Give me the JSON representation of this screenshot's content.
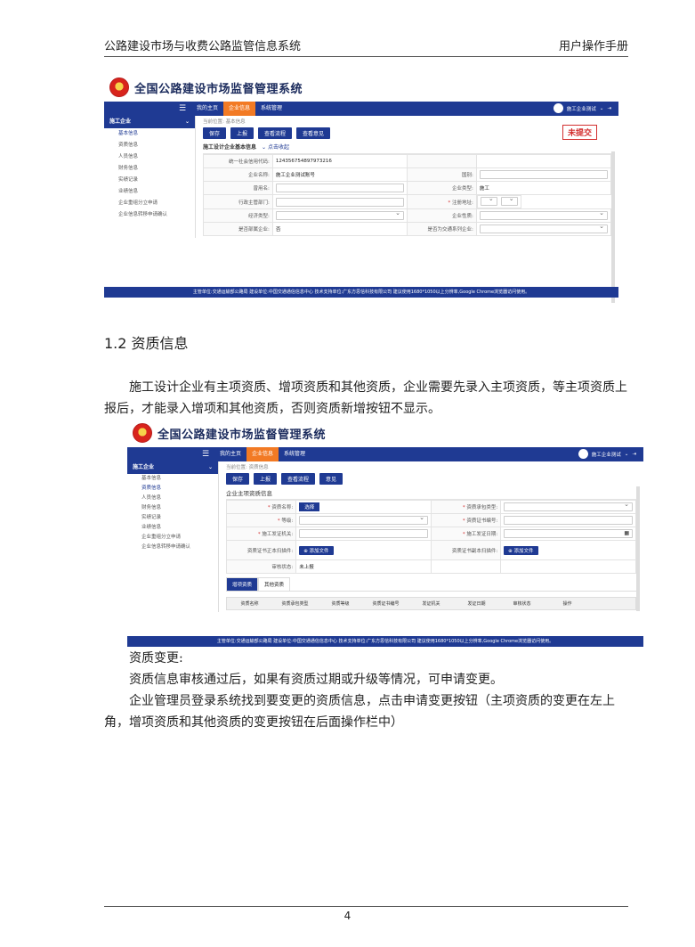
{
  "header": {
    "left": "公路建设市场与收费公路监管信息系统",
    "right": "用户操作手册"
  },
  "app": {
    "title": "全国公路建设市场监督管理系统",
    "nav": [
      "我的主页",
      "企业信息",
      "系统管理"
    ],
    "user": "施工企业测试",
    "footer": "主管单位:交通运输部公路局    建设单位:中国交通通信信息中心    技术支持单位:广东方思信科技有限公司    建议使用1680*1050以上分辨率,Google Chrome浏览器访问使用。",
    "sidebar_head": "施工企业",
    "sidebar_items": [
      "基本信息",
      "资质信息",
      "人员信息",
      "财务信息",
      "实绩记录",
      "业绩信息",
      "企业重组分立申请",
      "企业信息转移申请确认"
    ]
  },
  "shot1": {
    "crumb": "当前位置: 基本信息",
    "buttons": [
      "保存",
      "上报",
      "查看流程",
      "查看意见"
    ],
    "stamp": "未提交",
    "section": "施工设计企业基本信息",
    "toggle": "点击收起",
    "rows": [
      {
        "l1": "统一社会信用代码:",
        "v1": "124356754897973216",
        "l2": "",
        "v2": ""
      },
      {
        "l1": "企业名称:",
        "v1": "施工企业测试账号",
        "l2": "国别:",
        "v2": ""
      },
      {
        "l1": "曾用名:",
        "v1": "",
        "l2": "企业类型:",
        "v2": "施工"
      },
      {
        "l1": "行政主管部门:",
        "v1": "",
        "l2": "注册地址:",
        "v2": ""
      },
      {
        "l1": "经济类型:",
        "v1": "",
        "l2": "企业性质:",
        "v2": ""
      },
      {
        "l1": "是否部属企业:",
        "v1": "否",
        "l2": "是否为交通系列企业:",
        "v2": ""
      }
    ]
  },
  "heading": "1.2 资质信息",
  "para1": "施工设计企业有主项资质、增项资质和其他资质，企业需要先录入主项资质，等主项资质上报后，才能录入增项和其他资质，否则资质新增按钮不显示。",
  "shot2": {
    "crumb": "当前位置: 资质信息",
    "buttons": [
      "保存",
      "上报",
      "查看流程",
      "意见"
    ],
    "section": "企业主项资质信息",
    "rows": [
      {
        "l1": "资质名称:",
        "l2": "资质承包类型:"
      },
      {
        "l1": "等级:",
        "l2": "资质证书编号:"
      },
      {
        "l1": "施工发证机关:",
        "l2": "施工发证日期:"
      },
      {
        "l1": "资质证书正本扫描件:",
        "l2": "资质证书副本扫描件:"
      },
      {
        "l1": "审核状态:",
        "l2": ""
      }
    ],
    "choose": "选择",
    "add_file": "添加文件",
    "status": "未上报",
    "tabs": [
      "增项资质",
      "其他资质"
    ],
    "columns": [
      "资质名称",
      "资质承包类型",
      "资质等级",
      "资质证书编号",
      "发证机关",
      "发证日期",
      "审核状态",
      "操作",
      ""
    ]
  },
  "para2": {
    "line1": "资质变更:",
    "line2": "资质信息审核通过后，如果有资质过期或升级等情况，可申请变更。",
    "line3": "企业管理员登录系统找到要变更的资质信息，点击申请变更按钮（主项资质的变更在左上角，增项资质和其他资质的变更按钮在后面操作栏中）"
  },
  "page_number": "4"
}
